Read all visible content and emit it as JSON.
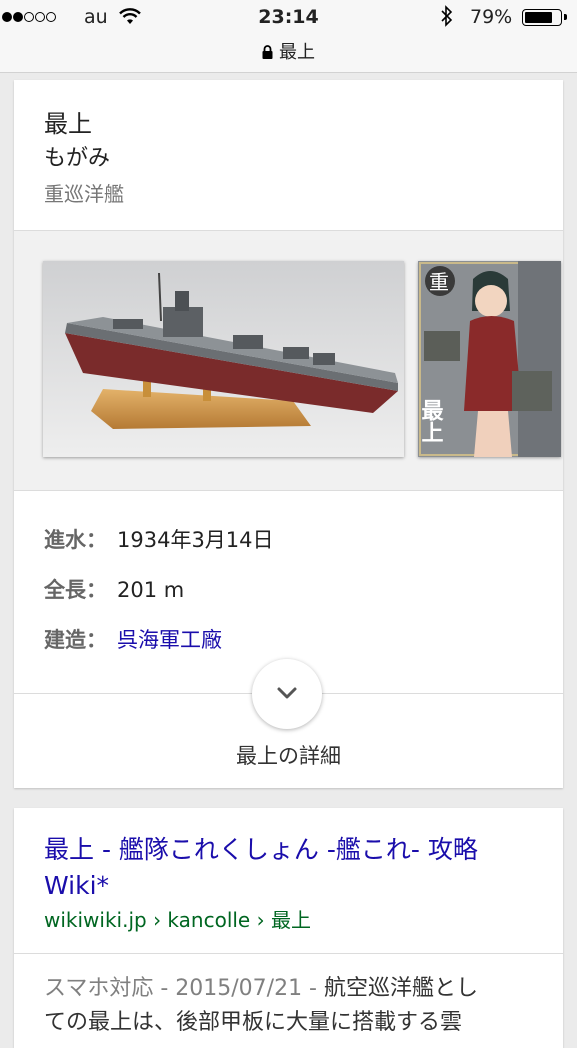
{
  "status_bar": {
    "carrier": "au",
    "time": "23:14",
    "battery_percent": "79%",
    "battery_level": 0.79,
    "signal_bars_filled": 2,
    "signal_bars_total": 5
  },
  "url_bar": {
    "title": "最上"
  },
  "knowledge_panel": {
    "title": "最上",
    "reading": "もがみ",
    "type": "重巡洋艦",
    "images": [
      {
        "subject": "ship-model-photo"
      },
      {
        "subject": "character-card",
        "badge": "重",
        "name": "最上"
      }
    ],
    "facts": [
      {
        "label": "進水：",
        "value": "1934年3月14日"
      },
      {
        "label": "全長：",
        "value": "201 m"
      },
      {
        "label": "建造：",
        "value": "呉海軍工廠",
        "is_link": true
      }
    ],
    "more_label": "最上の詳細"
  },
  "result": {
    "title": "最上 - 艦隊これくしょん -艦これ- 攻略 Wiki*",
    "url": "wikiwiki.jp › kancolle › 最上",
    "snippet_meta": "スマホ対応 - 2015/07/21 - ",
    "snippet": "航空巡洋艦とし",
    "snippet_line2": "ての最上は、後部甲板に大量に搭載する雲"
  },
  "colors": {
    "link": "#1a0dab",
    "url_green": "#006621",
    "background": "#ebebeb"
  }
}
